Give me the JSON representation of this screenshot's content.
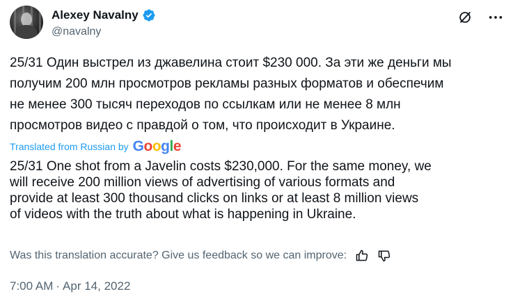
{
  "author": {
    "name": "Alexey Navalny",
    "handle": "@navalny"
  },
  "icons": {
    "verified": "verified-badge-icon",
    "grok": "grok-icon",
    "more": "more-options-icon",
    "thumbs_up": "thumbs-up-icon",
    "thumbs_down": "thumbs-down-icon"
  },
  "tweet": {
    "original_lines": [
      "25/31 Один выстрел из джавелина стоит $230 000. За эти же деньги мы",
      "получим 200 млн просмотров рекламы разных форматов и обеспечим",
      "не менее 300 тысяч переходов по ссылкам или не менее 8 млн",
      "просмотров видео с правдой о том, что происходит в Украине."
    ],
    "translated_label": "Translated from Russian by",
    "translation_provider": "Google",
    "translation_lines": [
      "25/31 One shot from a Javelin costs $230,000. For the same money, we",
      "will receive 200 million views of advertising of various formats and",
      "provide at least 300 thousand clicks on links or at least 8 million views",
      "of videos with the truth about what is happening in Ukraine."
    ],
    "feedback_prompt": "Was this translation accurate? Give us feedback so we can improve:",
    "time": "7:00 AM",
    "separator": "·",
    "date": "Apr 14, 2022"
  },
  "colors": {
    "accent": "#1d9bf0",
    "secondary_text": "#536471",
    "primary_text": "#0f1419",
    "google_blue": "#4285F4",
    "google_red": "#EA4335",
    "google_yellow": "#FBBC05",
    "google_green": "#34A853"
  }
}
